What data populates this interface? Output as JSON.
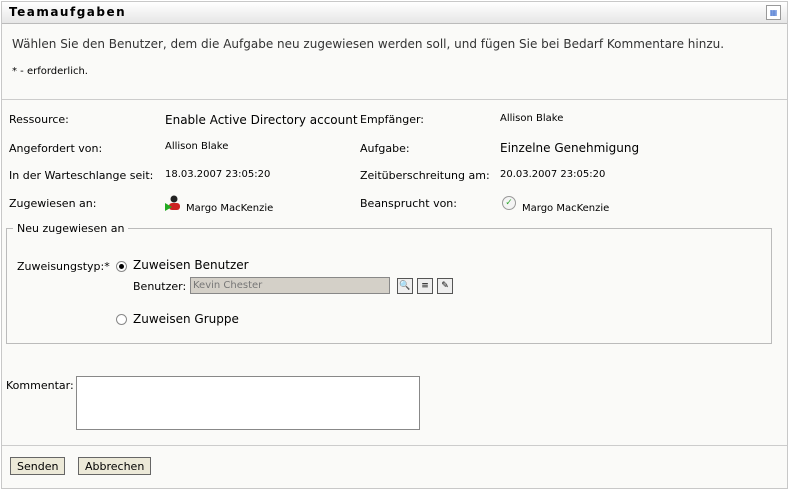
{
  "title": "Teamaufgaben",
  "instruction": "Wählen Sie den Benutzer, dem die Aufgabe neu zugewiesen werden soll, und fügen Sie bei Bedarf Kommentare hinzu.",
  "required_note": "* - erforderlich.",
  "details": {
    "resource_label": "Ressource:",
    "resource": "Enable Active Directory account",
    "recipient_label": "Empfänger:",
    "recipient": "Allison Blake",
    "requested_by_label": "Angefordert von:",
    "requested_by": "Allison Blake",
    "task_label": "Aufgabe:",
    "task": "Einzelne Genehmigung",
    "queued_label": "In der Warteschlange seit:",
    "queued": "18.03.2007 23:05:20",
    "timeout_label": "Zeitüberschreitung am:",
    "timeout": "20.03.2007 23:05:20",
    "assigned_label": "Zugewiesen an:",
    "assigned": "Margo MacKenzie",
    "claimed_label": "Beansprucht von:",
    "claimed": "Margo MacKenzie"
  },
  "reassign": {
    "legend": "Neu zugewiesen an",
    "type_label": "Zuweisungstyp:*",
    "option_user": "Zuweisen Benutzer",
    "user_label": "Benutzer:",
    "user_value": "Kevin Chester",
    "option_group": "Zuweisen Gruppe"
  },
  "comment_label": "Kommentar:",
  "buttons": {
    "send": "Senden",
    "cancel": "Abbrechen"
  }
}
